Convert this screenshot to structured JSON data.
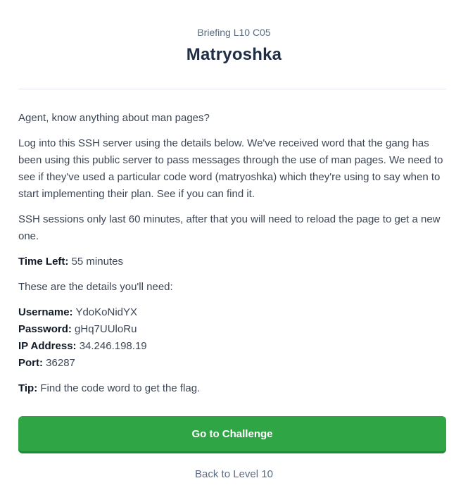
{
  "header": {
    "subtitle": "Briefing L10 C05",
    "title": "Matryoshka"
  },
  "briefing": {
    "intro": "Agent, know anything about man pages?",
    "paragraph": "Log into this SSH server using the details below. We've received word that the gang has been using this public server to pass messages through the use of man pages. We need to see if they've used a particular code word (matryoshka) which they're using to say when to start implementing their plan. See if you can find it.",
    "session_note": "SSH sessions only last 60 minutes, after that you will need to reload the page to get a new one.",
    "time_left_label": "Time Left:",
    "time_left_value": "55 minutes",
    "details_intro": "These are the details you'll need:",
    "username_label": "Username:",
    "username_value": "YdoKoNidYX",
    "password_label": "Password:",
    "password_value": "gHq7UUloRu",
    "ip_label": "IP Address:",
    "ip_value": "34.246.198.19",
    "port_label": "Port:",
    "port_value": "36287",
    "tip_label": "Tip:",
    "tip_value": "Find the code word to get the flag."
  },
  "actions": {
    "go_label": "Go to Challenge",
    "back_label": "Back to Level 10"
  },
  "colors": {
    "accent_green": "#2fa545",
    "title_navy": "#1f2e44",
    "muted_slate": "#5a6b82"
  }
}
